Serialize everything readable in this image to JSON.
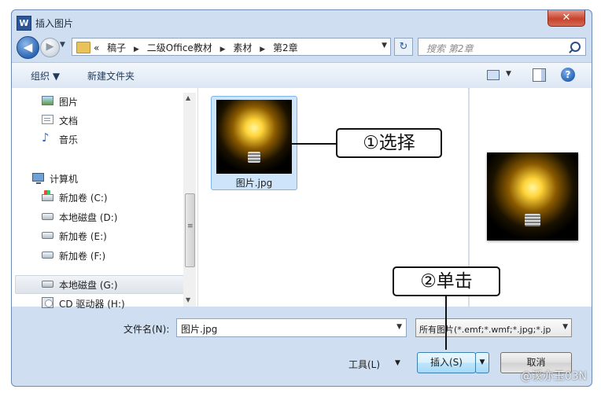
{
  "window": {
    "app_icon": "W",
    "title": "插入图片",
    "close": "✕"
  },
  "navigation": {
    "back": "◀",
    "forward": "▶",
    "history_arrow": "▼",
    "breadcrumbs": [
      "«",
      "稿子",
      "二级Office教材",
      "素材",
      "第2章"
    ],
    "refresh": "↻",
    "search_placeholder": "搜索 第2章"
  },
  "toolbar": {
    "organize": "组织 ▼",
    "new_folder": "新建文件夹",
    "view_arrow": "▼",
    "help": "?"
  },
  "sidebar": {
    "items": [
      {
        "label": "图片",
        "icon": "picture-icon"
      },
      {
        "label": "文档",
        "icon": "document-icon"
      },
      {
        "label": "音乐",
        "icon": "music-icon"
      },
      {
        "label": "计算机",
        "icon": "computer-icon"
      },
      {
        "label": "新加卷 (C:)",
        "icon": "system-drive-icon"
      },
      {
        "label": "本地磁盘 (D:)",
        "icon": "drive-icon"
      },
      {
        "label": "新加卷 (E:)",
        "icon": "drive-icon"
      },
      {
        "label": "新加卷 (F:)",
        "icon": "drive-icon"
      },
      {
        "label": "本地磁盘 (G:)",
        "icon": "drive-icon"
      },
      {
        "label": "CD 驱动器 (H:)",
        "icon": "cd-drive-icon"
      }
    ],
    "selected_index": 8,
    "scroll_up": "▲",
    "scroll_down": "▼",
    "scroll_grip": "≡"
  },
  "files": [
    {
      "name": "图片.jpg",
      "selected": true
    }
  ],
  "bottom": {
    "filename_label": "文件名(N):",
    "filename_value": "图片.jpg",
    "dropdown_arrow": "▼",
    "filetype": "所有图片(*.emf;*.wmf;*.jpg;*.jp",
    "tools": "工具(L)",
    "insert": "插入(S)",
    "cancel": "取消"
  },
  "annotations": {
    "step1": "①选择",
    "step2": "②单击"
  },
  "watermark": "@溪亦玉03N",
  "colors": {
    "selection": "#cde4fa",
    "frame": "#cfdff1",
    "accent": "#2d67b4"
  }
}
